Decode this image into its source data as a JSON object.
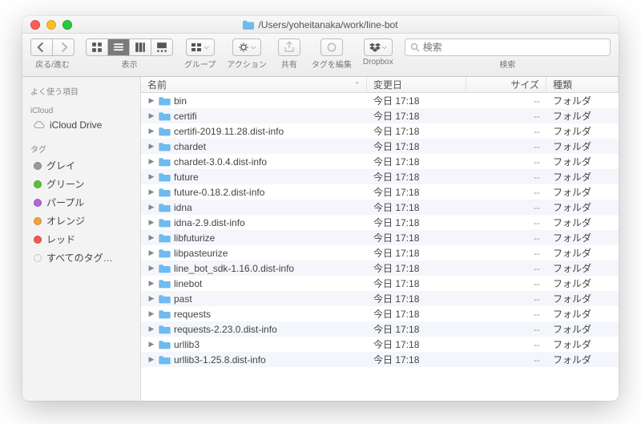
{
  "title": {
    "path": "/Users/yoheitanaka/work/line-bot"
  },
  "toolbar": {
    "back_fwd": "戻る/進む",
    "view": "表示",
    "group": "グループ",
    "action": "アクション",
    "share": "共有",
    "tags": "タグを編集",
    "dropbox": "Dropbox",
    "search": "検索",
    "search_placeholder": "検索"
  },
  "sidebar": {
    "favorites": "よく使う項目",
    "icloud_sec": "iCloud",
    "icloud_drive": "iCloud Drive",
    "tags_sec": "タグ",
    "tags": [
      {
        "label": "グレイ",
        "cls": "grey"
      },
      {
        "label": "グリーン",
        "cls": "green"
      },
      {
        "label": "パープル",
        "cls": "purple"
      },
      {
        "label": "オレンジ",
        "cls": "orange"
      },
      {
        "label": "レッド",
        "cls": "red"
      },
      {
        "label": "すべてのタグ…",
        "cls": "all"
      }
    ]
  },
  "columns": {
    "name": "名前",
    "date": "変更日",
    "size": "サイズ",
    "kind": "種類"
  },
  "rows": [
    {
      "name": "bin",
      "date": "今日 17:18",
      "size": "--",
      "kind": "フォルダ"
    },
    {
      "name": "certifi",
      "date": "今日 17:18",
      "size": "--",
      "kind": "フォルダ"
    },
    {
      "name": "certifi-2019.11.28.dist-info",
      "date": "今日 17:18",
      "size": "--",
      "kind": "フォルダ"
    },
    {
      "name": "chardet",
      "date": "今日 17:18",
      "size": "--",
      "kind": "フォルダ"
    },
    {
      "name": "chardet-3.0.4.dist-info",
      "date": "今日 17:18",
      "size": "--",
      "kind": "フォルダ"
    },
    {
      "name": "future",
      "date": "今日 17:18",
      "size": "--",
      "kind": "フォルダ"
    },
    {
      "name": "future-0.18.2.dist-info",
      "date": "今日 17:18",
      "size": "--",
      "kind": "フォルダ"
    },
    {
      "name": "idna",
      "date": "今日 17:18",
      "size": "--",
      "kind": "フォルダ"
    },
    {
      "name": "idna-2.9.dist-info",
      "date": "今日 17:18",
      "size": "--",
      "kind": "フォルダ"
    },
    {
      "name": "libfuturize",
      "date": "今日 17:18",
      "size": "--",
      "kind": "フォルダ"
    },
    {
      "name": "libpasteurize",
      "date": "今日 17:18",
      "size": "--",
      "kind": "フォルダ"
    },
    {
      "name": "line_bot_sdk-1.16.0.dist-info",
      "date": "今日 17:18",
      "size": "--",
      "kind": "フォルダ"
    },
    {
      "name": "linebot",
      "date": "今日 17:18",
      "size": "--",
      "kind": "フォルダ"
    },
    {
      "name": "past",
      "date": "今日 17:18",
      "size": "--",
      "kind": "フォルダ"
    },
    {
      "name": "requests",
      "date": "今日 17:18",
      "size": "--",
      "kind": "フォルダ"
    },
    {
      "name": "requests-2.23.0.dist-info",
      "date": "今日 17:18",
      "size": "--",
      "kind": "フォルダ"
    },
    {
      "name": "urllib3",
      "date": "今日 17:18",
      "size": "--",
      "kind": "フォルダ"
    },
    {
      "name": "urllib3-1.25.8.dist-info",
      "date": "今日 17:18",
      "size": "--",
      "kind": "フォルダ"
    }
  ]
}
